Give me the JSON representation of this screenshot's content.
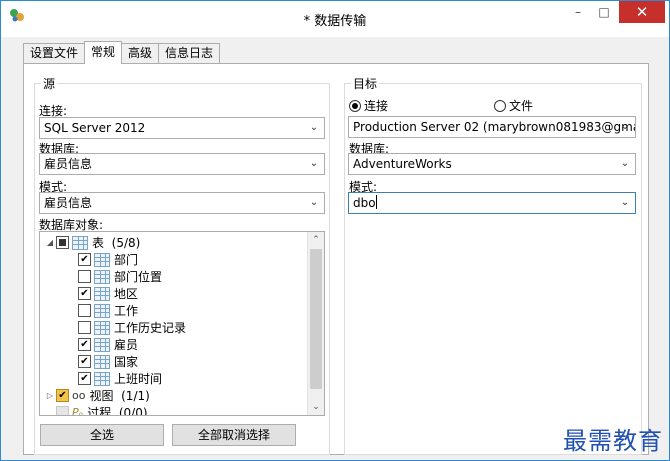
{
  "window": {
    "title": "* 数据传输",
    "controls": {
      "minimize": "–",
      "maximize": "□",
      "close": "✕"
    }
  },
  "tabs": [
    {
      "label": "设置文件",
      "active": false
    },
    {
      "label": "常规",
      "active": true
    },
    {
      "label": "高级",
      "active": false
    },
    {
      "label": "信息日志",
      "active": false
    }
  ],
  "source": {
    "group_title": "源",
    "connection_label": "连接:",
    "connection_value": "SQL Server 2012",
    "database_label": "数据库:",
    "database_value": "雇员信息",
    "schema_label": "模式:",
    "schema_value": "雇员信息",
    "objects_label": "数据库对象:",
    "tree": {
      "tables": {
        "label": "表",
        "count": "(5/8)"
      },
      "table_items": [
        {
          "label": "部门",
          "checked": true
        },
        {
          "label": "部门位置",
          "checked": false
        },
        {
          "label": "地区",
          "checked": true
        },
        {
          "label": "工作",
          "checked": false
        },
        {
          "label": "工作历史记录",
          "checked": false
        },
        {
          "label": "雇员",
          "checked": true
        },
        {
          "label": "国家",
          "checked": true
        },
        {
          "label": "上班时间",
          "checked": true
        }
      ],
      "views": {
        "label": "视图",
        "count": "(1/1)"
      },
      "procedures": {
        "label": "过程",
        "count": "(0/0)"
      }
    },
    "select_all_button": "全选",
    "deselect_all_button": "全部取消选择"
  },
  "target": {
    "group_title": "目标",
    "radio_connection": "连接",
    "radio_file": "文件",
    "connection_value": "Production Server 02 (marybrown081983@gma",
    "database_label": "数据库:",
    "database_value": "AdventureWorks",
    "schema_label": "模式:",
    "schema_value": "dbo"
  },
  "watermark": "最需教育",
  "colors": {
    "accent": "#2a8ad4",
    "close": "#c7302a",
    "watermark": "#2050b0"
  }
}
